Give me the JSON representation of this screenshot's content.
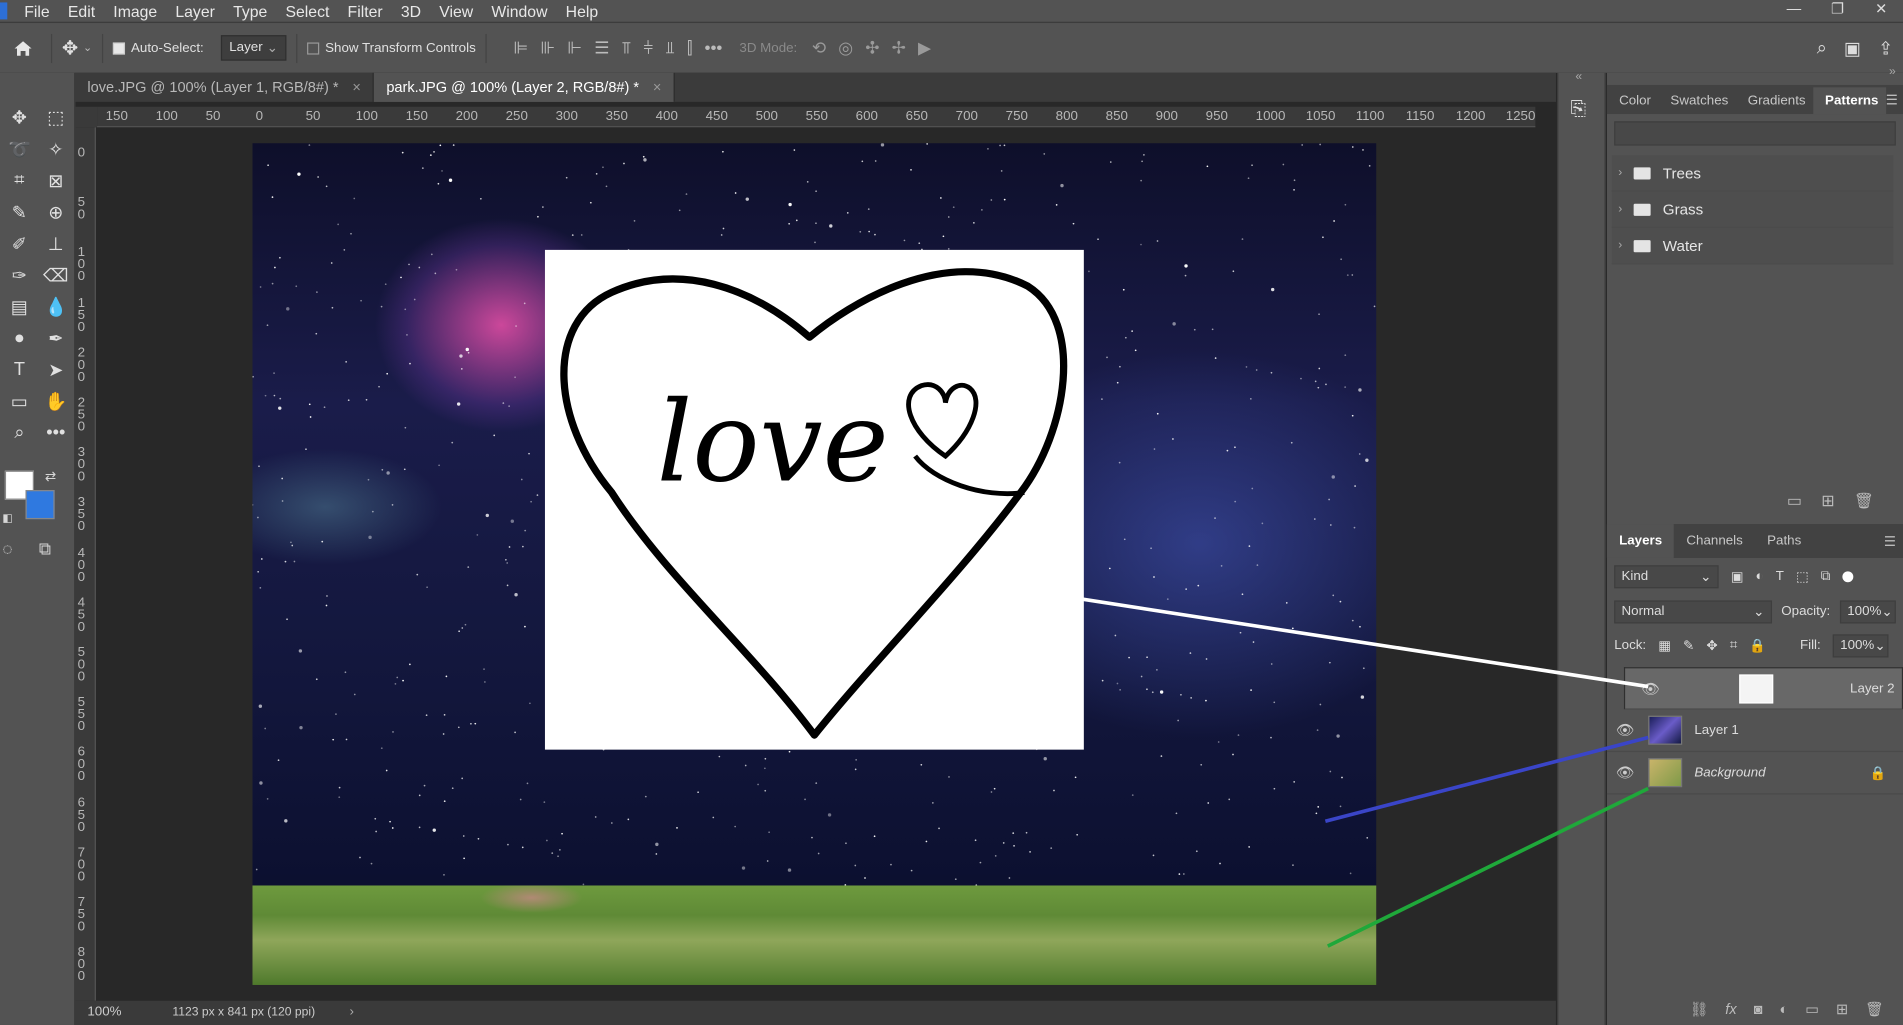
{
  "menu": [
    "File",
    "Edit",
    "Image",
    "Layer",
    "Type",
    "Select",
    "Filter",
    "3D",
    "View",
    "Window",
    "Help"
  ],
  "window_controls": [
    "—",
    "❐",
    "✕"
  ],
  "options": {
    "auto_select_label": "Auto-Select:",
    "auto_select_value": "Layer",
    "show_transform_label": "Show Transform Controls",
    "mode3d_label": "3D Mode:"
  },
  "tabs": [
    {
      "label": "love.JPG @ 100% (Layer 1, RGB/8#) *",
      "close": "×"
    },
    {
      "label": "park.JPG @ 100% (Layer 2, RGB/8#) *",
      "close": "×"
    }
  ],
  "ruler_h": [
    "150",
    "100",
    "50",
    "0",
    "50",
    "100",
    "150",
    "200",
    "250",
    "300",
    "350",
    "400",
    "450",
    "500",
    "550",
    "600",
    "650",
    "700",
    "750",
    "800",
    "850",
    "900",
    "950",
    "1000",
    "1050",
    "1100",
    "1150",
    "1200",
    "1250"
  ],
  "ruler_v": [
    "0",
    "50",
    "100",
    "150",
    "200",
    "250",
    "300",
    "350",
    "400",
    "450",
    "500",
    "550",
    "600",
    "650",
    "700",
    "750",
    "800"
  ],
  "status": {
    "zoom": "100%",
    "doc": "1123 px x 841 px (120 ppi)"
  },
  "panel_tabs": [
    "Color",
    "Swatches",
    "Gradients",
    "Patterns"
  ],
  "pattern_folders": [
    "Trees",
    "Grass",
    "Water"
  ],
  "layer_tabs": [
    "Layers",
    "Channels",
    "Paths"
  ],
  "layer_controls": {
    "kind": "Kind",
    "blend": "Normal",
    "opacity_label": "Opacity:",
    "opacity": "100%",
    "lock_label": "Lock:",
    "fill_label": "Fill:",
    "fill": "100%"
  },
  "layers": [
    {
      "name": "Layer 2",
      "selected": true
    },
    {
      "name": "Layer 1",
      "selected": false
    },
    {
      "name": "Background",
      "selected": false,
      "locked": true
    }
  ],
  "artwork_text": "love",
  "colors": {
    "foreground": "#ffffff",
    "background": "#2f79e0",
    "arrow_layer2": "#ffffff",
    "arrow_layer1": "#3a45c8",
    "arrow_background": "#1fa83a"
  }
}
